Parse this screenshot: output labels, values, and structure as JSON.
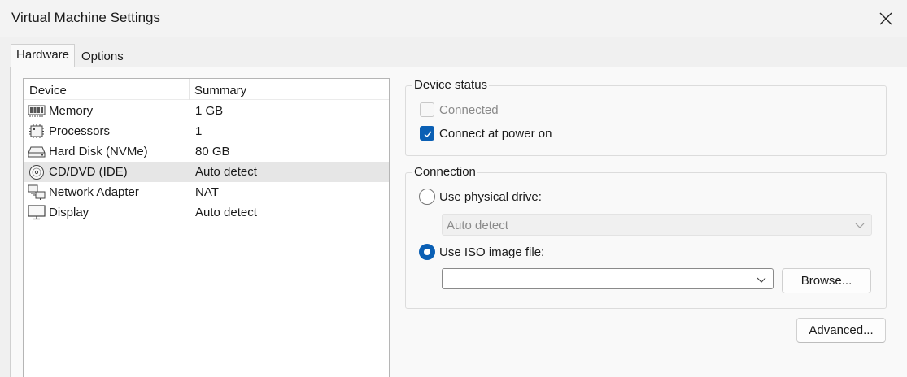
{
  "window": {
    "title": "Virtual Machine Settings",
    "close_icon": "close-icon"
  },
  "tabs": [
    {
      "label": "Hardware",
      "active": true
    },
    {
      "label": "Options",
      "active": false
    }
  ],
  "device_list": {
    "columns": [
      "Device",
      "Summary"
    ],
    "rows": [
      {
        "icon": "memory-icon",
        "device": "Memory",
        "summary": "1 GB",
        "selected": false
      },
      {
        "icon": "processor-icon",
        "device": "Processors",
        "summary": "1",
        "selected": false
      },
      {
        "icon": "hard-disk-icon",
        "device": "Hard Disk (NVMe)",
        "summary": "80 GB",
        "selected": false
      },
      {
        "icon": "cd-dvd-icon",
        "device": "CD/DVD (IDE)",
        "summary": "Auto detect",
        "selected": true
      },
      {
        "icon": "network-adapter-icon",
        "device": "Network Adapter",
        "summary": "NAT",
        "selected": false
      },
      {
        "icon": "display-icon",
        "device": "Display",
        "summary": "Auto detect",
        "selected": false
      }
    ]
  },
  "device_status": {
    "title": "Device status",
    "connected": {
      "label": "Connected",
      "checked": false,
      "disabled": true
    },
    "connect_at_power_on": {
      "label": "Connect at power on",
      "checked": true,
      "disabled": false
    }
  },
  "connection": {
    "title": "Connection",
    "physical_drive": {
      "label": "Use physical drive:",
      "selected": false
    },
    "physical_drive_select": {
      "value": "Auto detect",
      "disabled": true
    },
    "iso_image": {
      "label": "Use ISO image file:",
      "selected": true
    },
    "iso_path": {
      "value": ""
    },
    "browse_label": "Browse..."
  },
  "advanced_label": "Advanced...",
  "colors": {
    "accent": "#0a5fb4",
    "selected_row": "#e6e6e6",
    "disabled_text": "#8a8a8a"
  }
}
